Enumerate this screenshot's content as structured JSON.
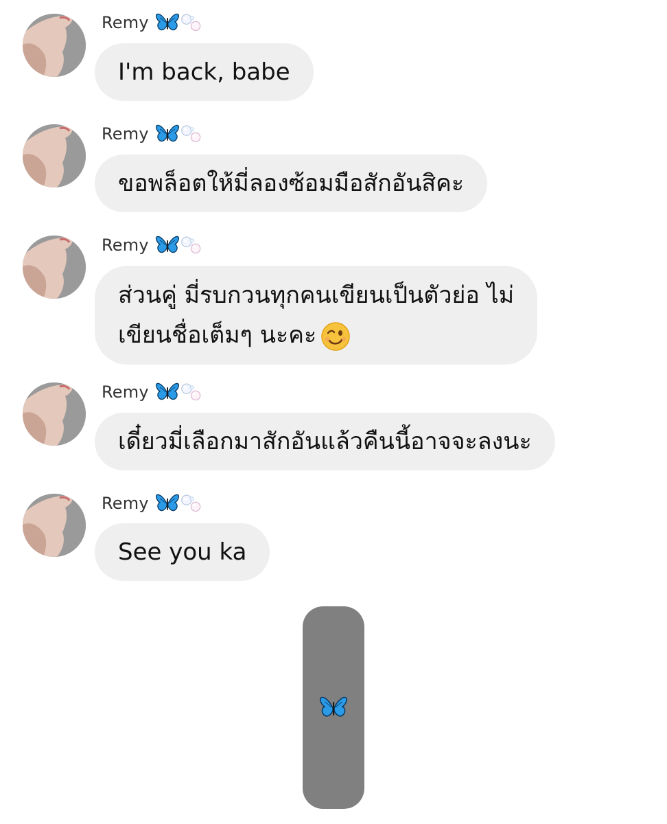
{
  "conversation": {
    "sender_name": "Remy",
    "messages": [
      {
        "sender": "Remy",
        "lines": [
          "I'm back, babe"
        ]
      },
      {
        "sender": "Remy",
        "lines": [
          "ขอพล็อตให้มี่ลองซ้อมมือสักอันสิคะ"
        ]
      },
      {
        "sender": "Remy",
        "lines": [
          "ส่วนคู่ มี่รบกวนทุกคนเขียนเป็นตัวย่อ ไม่",
          "เขียนชื่อเต็มๆ นะคะ"
        ],
        "trailing_emoji": "winking-face-emoji"
      },
      {
        "sender": "Remy",
        "lines": [
          "เดี๋ยวมี่เลือกมาสักอันแล้วคืนนี้อาจจะลงนะ"
        ]
      },
      {
        "sender": "Remy",
        "lines": [
          "See you ka"
        ]
      }
    ],
    "name_decoration_icons": [
      "butterfly-icon",
      "bubbles-icon"
    ]
  },
  "bottom_button": {
    "icon": "butterfly-icon"
  },
  "colors": {
    "bubble_bg": "#efefef",
    "button_bg": "#808080",
    "butterfly_blue": "#2b9be8"
  }
}
